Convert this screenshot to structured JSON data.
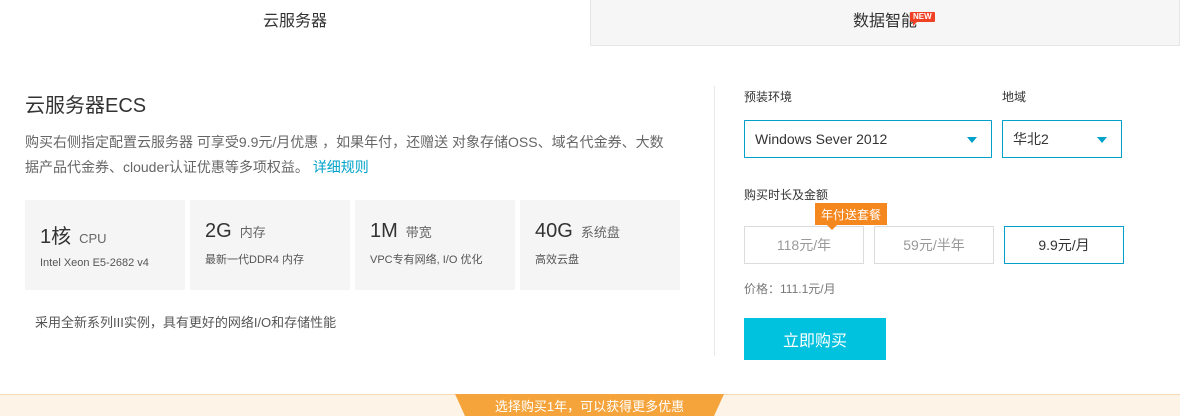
{
  "tabs": [
    {
      "label": "云服务器",
      "active": true
    },
    {
      "label": "数据智能",
      "active": false,
      "badge": "NEW"
    }
  ],
  "product": {
    "title": "云服务器ECS",
    "description": "购买右侧指定配置云服务器 可享受9.9元/月优惠 ，如果年付，还赠送 对象存储OSS、域名代金券、大数据产品代金券、clouder认证优惠等多项权益。",
    "detail_link": "详细规则"
  },
  "specs": [
    {
      "value": "1核",
      "unit": "CPU",
      "sub": "Intel Xeon E5-2682 v4"
    },
    {
      "value": "2G",
      "unit": "内存",
      "sub": "最新一代DDR4 内存"
    },
    {
      "value": "1M",
      "unit": "带宽",
      "sub": "VPC专有网络, I/O 优化"
    },
    {
      "value": "40G",
      "unit": "系统盘",
      "sub": "高效云盘"
    }
  ],
  "footnote": "采用全新系列III实例，具有更好的网络I/O和存储性能",
  "config": {
    "env_label": "预装环境",
    "env_value": "Windows Sever 2012",
    "region_label": "地域",
    "region_value": "华北2",
    "duration_label": "购买时长及金额",
    "promo_tag": "年付送套餐",
    "durations": [
      {
        "label": "118元/年",
        "selected": false
      },
      {
        "label": "59元/半年",
        "selected": false
      },
      {
        "label": "9.9元/月",
        "selected": true
      }
    ],
    "price_text": "价格：111.1元/月",
    "buy_label": "立即购买"
  },
  "banner": {
    "text": "选择购买1年，可以获得更多优惠"
  },
  "colors": {
    "accent": "#00a2ca",
    "buy_button": "#00c1de",
    "promo": "#f5871f",
    "new_badge": "#f04124",
    "banner_tab": "#f5a43c"
  }
}
